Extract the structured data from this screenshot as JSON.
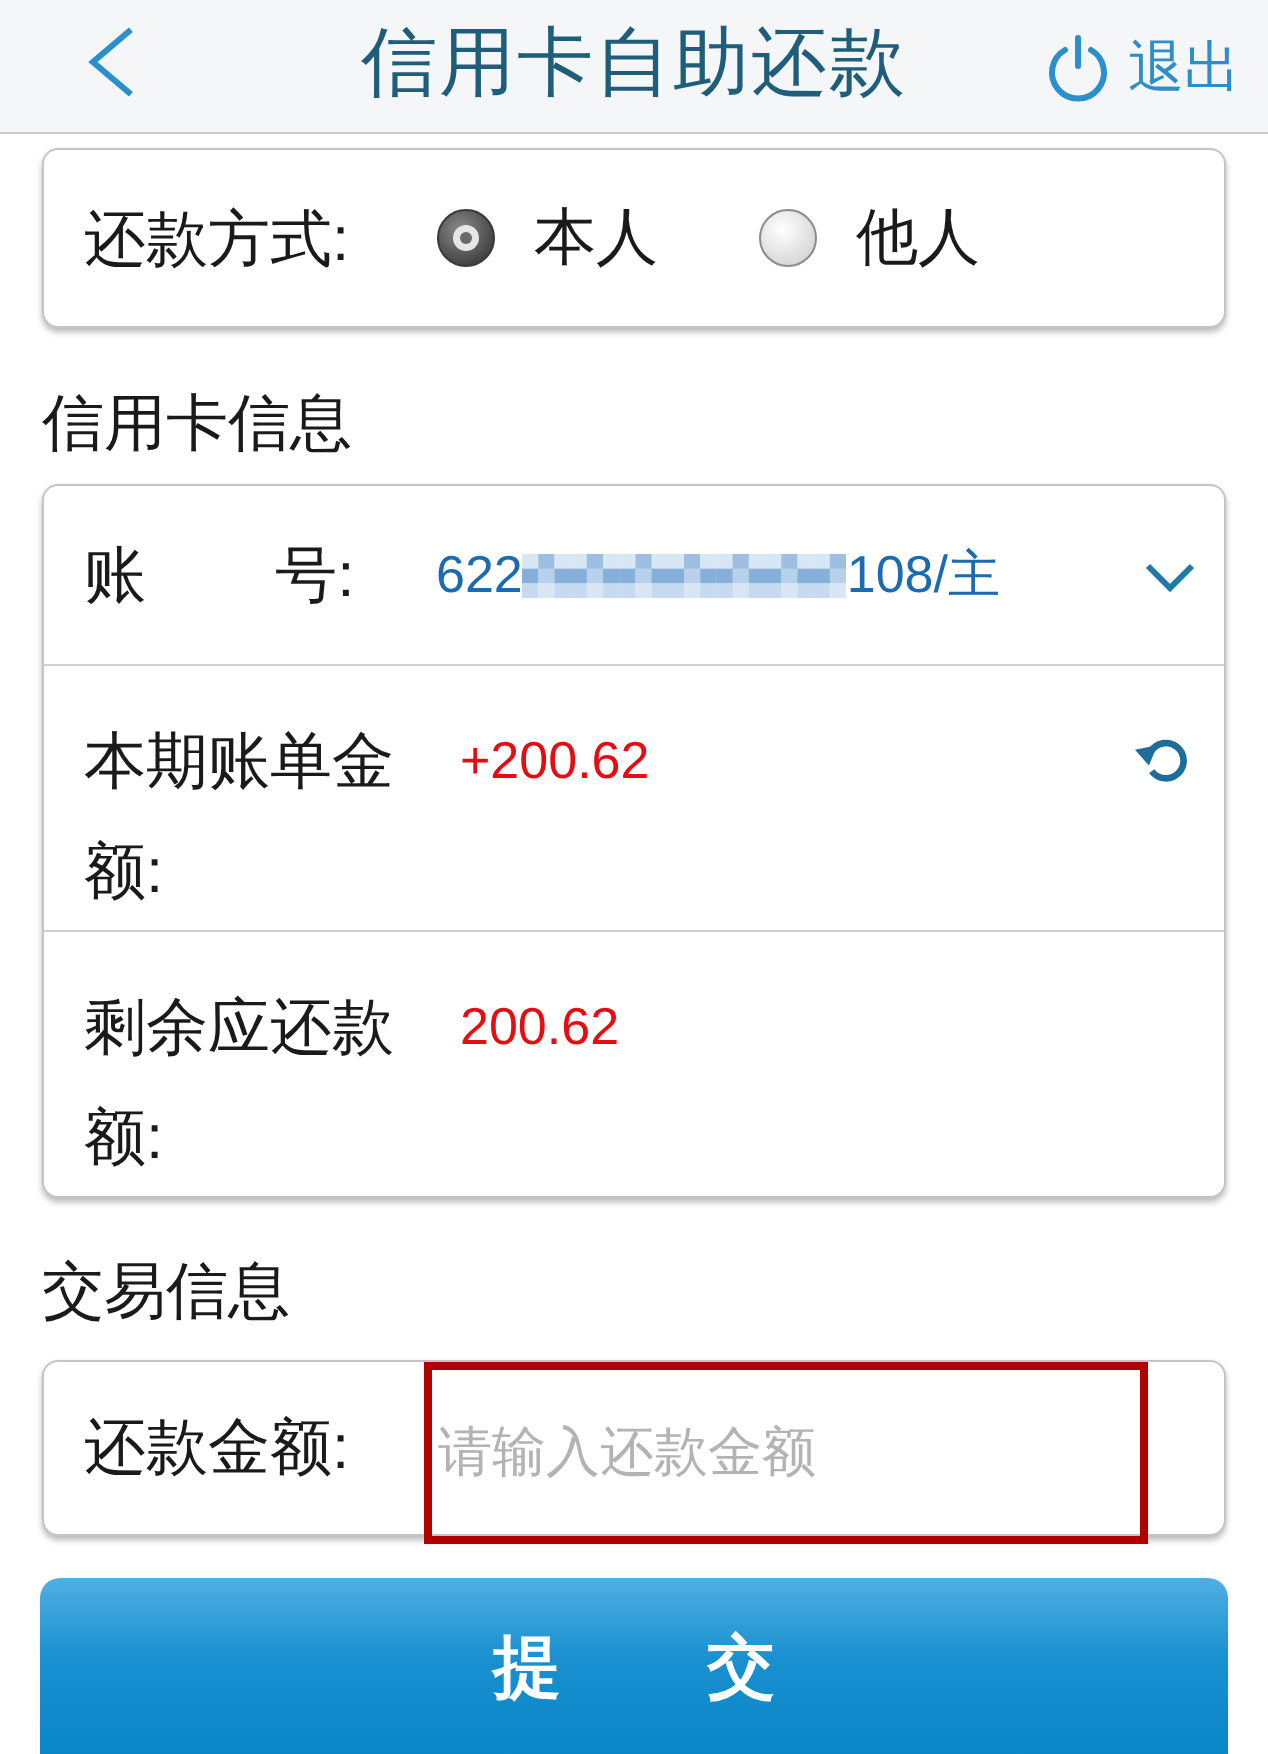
{
  "header": {
    "title": "信用卡自助还款",
    "logout": "退出"
  },
  "repayment_method": {
    "label": "还款方式:",
    "options": [
      {
        "label": "本人",
        "selected": true
      },
      {
        "label": "他人",
        "selected": false
      }
    ]
  },
  "card_info": {
    "title": "信用卡信息",
    "rows": [
      {
        "kind": "account",
        "label": "账 号:",
        "value_start": "622",
        "value_end": "108/主"
      },
      {
        "kind": "amount",
        "label": "本期账单金额:",
        "value": "+200.62",
        "refreshable": true
      },
      {
        "kind": "amount",
        "label": "剩余应还款额:",
        "value": "200.62",
        "refreshable": false
      }
    ]
  },
  "transaction_info": {
    "title": "交易信息",
    "amount_field": {
      "label": "还款金额:",
      "placeholder": "请输入还款金额",
      "highlighted": true
    }
  },
  "submit_button": "提 交"
}
